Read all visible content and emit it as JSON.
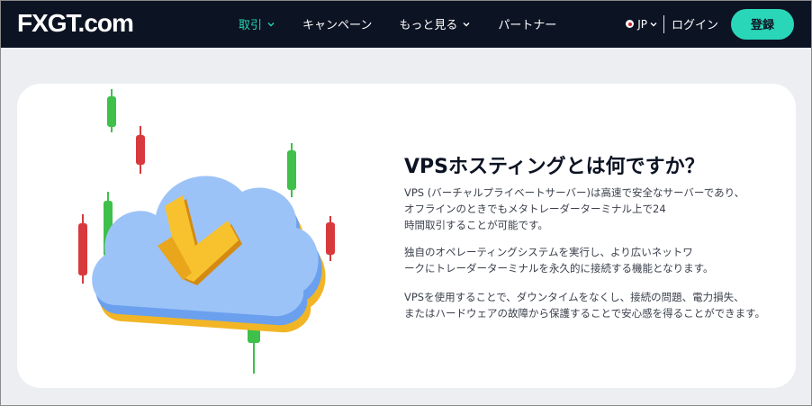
{
  "header": {
    "logo": "FXGT.com",
    "nav": [
      {
        "label": "取引",
        "has_dropdown": true,
        "active": true
      },
      {
        "label": "キャンペーン",
        "has_dropdown": false,
        "active": false
      },
      {
        "label": "もっと見る",
        "has_dropdown": true,
        "active": false
      },
      {
        "label": "パートナー",
        "has_dropdown": false,
        "active": false
      }
    ],
    "language": "JP",
    "login": "ログイン",
    "register": "登録"
  },
  "colors": {
    "navbar_bg": "#0c1323",
    "accent": "#2ad6b8",
    "page_bg": "#eceef1",
    "candle_green": "#3fc04a",
    "candle_red": "#d8393d",
    "cloud": "#8fb9f4",
    "arrow": "#f2b526"
  },
  "content": {
    "heading": "VPSホスティングとは何ですか？",
    "paragraphs": [
      [
        "VPS (バーチャルプライベートサーバー)は高速で安全なサーバーであり、",
        "オフラインのときでもメタトレーダーターミナル上で24",
        "時間取引することが可能です。"
      ],
      [
        "独自のオペレーティングシステムを実行し、より広いネットワ",
        "ークにトレーダーターミナルを永久的に接続する機能となります。"
      ],
      [
        "VPSを使用することで、ダウンタイムをなくし、接続の問題、電力損失、",
        "またはハードウェアの故障から保護することで安心感を得ることができます。"
      ]
    ]
  },
  "illustration": {
    "icons": [
      "cloud-icon",
      "download-arrow-icon",
      "candlestick-icon"
    ]
  }
}
